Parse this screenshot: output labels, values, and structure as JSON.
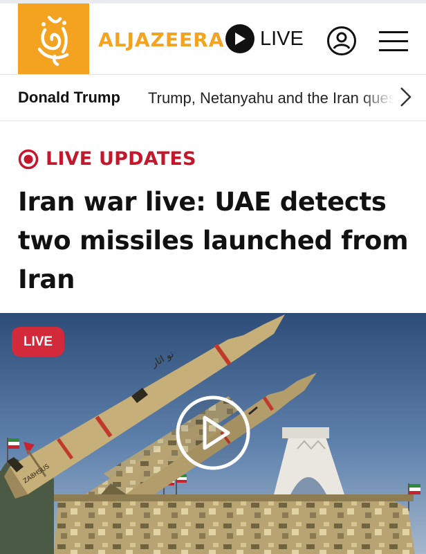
{
  "header": {
    "brand": "ALJAZEERA",
    "logo_alt": "Al Jazeera logo",
    "live_label": "LIVE",
    "icons": {
      "play": "play-icon",
      "account": "user-icon",
      "menu": "hamburger-menu-icon"
    }
  },
  "topics": {
    "items": [
      {
        "label": "Donald Trump"
      },
      {
        "label": "Trump, Netanyahu and the Iran question"
      }
    ],
    "more_icon": "chevron-right-icon"
  },
  "article": {
    "live_updates_label": "LIVE UPDATES",
    "headline": "Iran war live: UAE detects two missiles launched from Iran",
    "media": {
      "badge": "LIVE",
      "play_icon": "play-circle-icon",
      "missile_text": "نو اثار",
      "missile_serial": "ZA8HSUS"
    }
  },
  "colors": {
    "brand_orange": "#f4a321",
    "live_red": "#c5172c",
    "badge_red": "#d32a3b",
    "text": "#111111"
  }
}
